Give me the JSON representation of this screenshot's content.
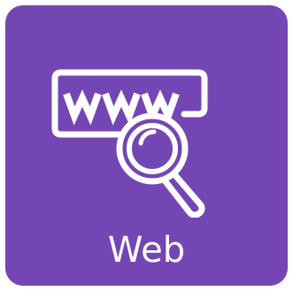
{
  "tile": {
    "label": "Web",
    "icon": "web-search-icon",
    "background_color": "#7446b3",
    "foreground_color": "#ffffff"
  }
}
